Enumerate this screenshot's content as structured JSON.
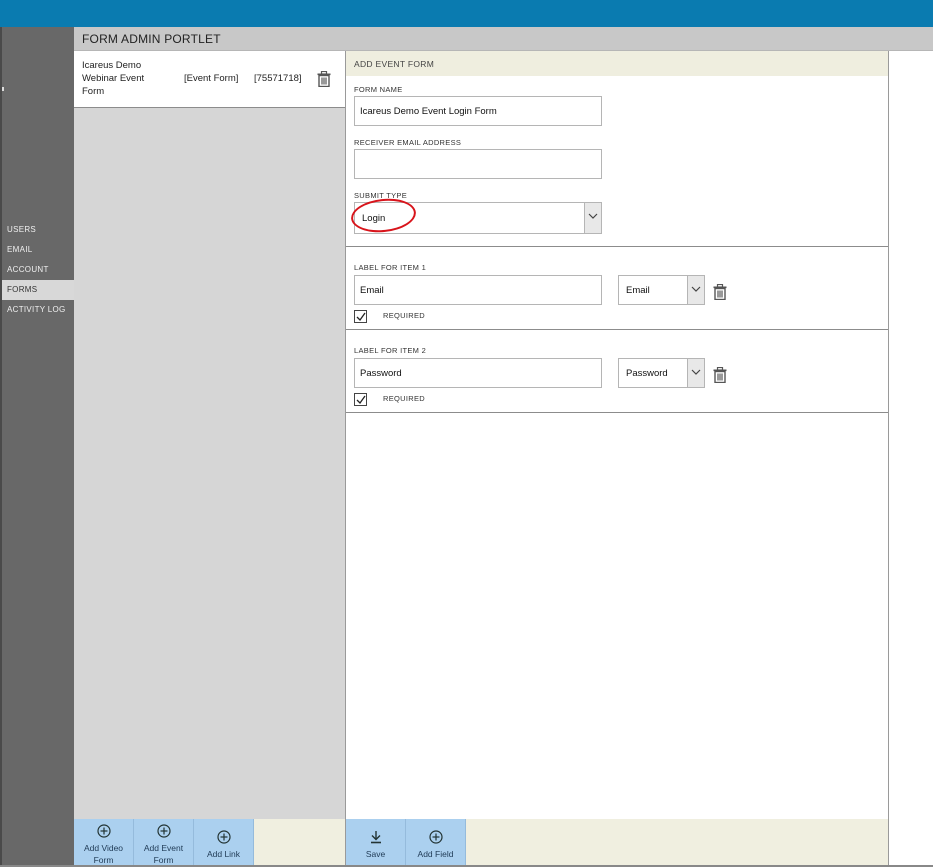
{
  "portlet": {
    "title": "FORM ADMIN PORTLET"
  },
  "sidebar": {
    "items": [
      {
        "label": "USERS",
        "active": false
      },
      {
        "label": "EMAIL",
        "active": false
      },
      {
        "label": "ACCOUNT",
        "active": false
      },
      {
        "label": "FORMS",
        "active": true
      },
      {
        "label": "ACTIVITY LOG",
        "active": false
      }
    ]
  },
  "form_list": {
    "rows": [
      {
        "name": "Icareus Demo Webinar Event Form",
        "type": "[Event Form]",
        "id": "[75571718]"
      }
    ]
  },
  "add_event_form": {
    "title": "ADD EVENT FORM",
    "form_name": {
      "label": "FORM NAME",
      "value": "Icareus Demo Event Login Form"
    },
    "receiver_email": {
      "label": "RECEIVER EMAIL ADDRESS",
      "value": ""
    },
    "submit_type": {
      "label": "SUBMIT TYPE",
      "value": "Login"
    },
    "items": [
      {
        "label": "LABEL FOR ITEM 1",
        "value": "Email",
        "type": "Email",
        "required_label": "REQUIRED",
        "required": true
      },
      {
        "label": "LABEL FOR ITEM 2",
        "value": "Password",
        "type": "Password",
        "required_label": "REQUIRED",
        "required": true
      }
    ]
  },
  "footer_left": {
    "buttons": [
      {
        "label_lines": [
          "Add Video",
          "Form"
        ]
      },
      {
        "label_lines": [
          "Add Event",
          "Form"
        ]
      },
      {
        "label_lines": [
          "Add Link"
        ]
      }
    ]
  },
  "footer_right": {
    "buttons": [
      {
        "label": "Save"
      },
      {
        "label": "Add Field"
      }
    ]
  },
  "colors": {
    "topbar": "#0a7bb0",
    "sidebar": "#686868",
    "footer_button": "#abd0ef",
    "annotation_circle": "#d8141b"
  }
}
